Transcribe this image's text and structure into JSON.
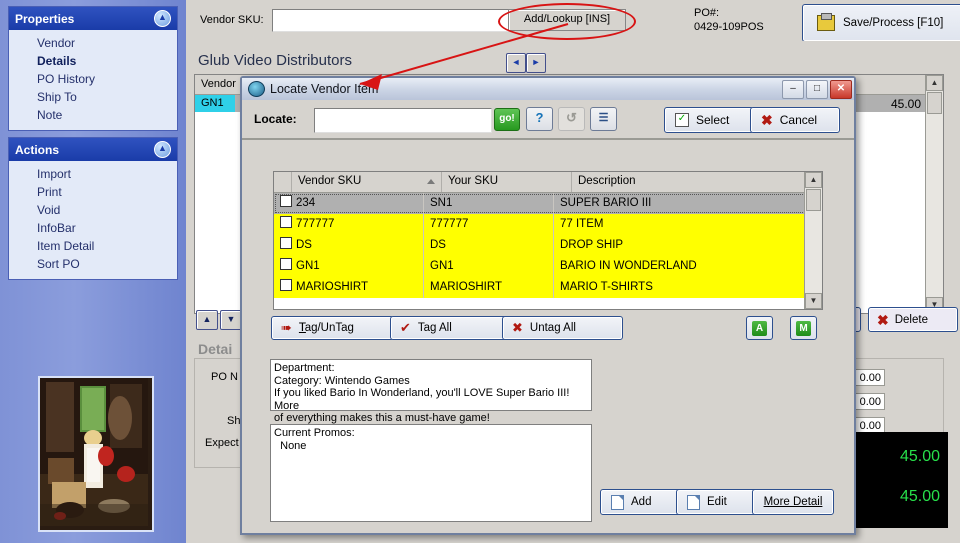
{
  "sidebar": {
    "properties": {
      "title": "Properties",
      "collapse_icon": "chevron-up-icon",
      "items": [
        {
          "label": "Vendor",
          "selected": false
        },
        {
          "label": "Details",
          "selected": true
        },
        {
          "label": "PO History",
          "selected": false
        },
        {
          "label": "Ship To",
          "selected": false
        },
        {
          "label": "Note",
          "selected": false
        }
      ]
    },
    "actions": {
      "title": "Actions",
      "collapse_icon": "chevron-up-icon",
      "items": [
        {
          "label": "Import"
        },
        {
          "label": "Print"
        },
        {
          "label": "Void"
        },
        {
          "label": "InfoBar"
        },
        {
          "label": "Item Detail"
        },
        {
          "label": "Sort PO"
        }
      ]
    },
    "thumbnail": {
      "name": "attic-painting-thumbnail"
    }
  },
  "topbar": {
    "vendor_sku_label": "Vendor SKU:",
    "vendor_sku_value": "",
    "add_lookup_label": "Add/Lookup [INS]",
    "po_label": "PO#:",
    "po_number": "0429-109POS",
    "save_process_label": "Save/Process [F10]",
    "save_icon": "save-disk-icon"
  },
  "background": {
    "vendor_title": "Glub Video Distributors",
    "nav_prev": "◄",
    "nav_next": "►",
    "grid_header": "Vendor",
    "grid_row_sku": "GN1",
    "grid_row_amount": "45.00",
    "move_up_icon": "move-up-icon",
    "move_down_icon": "move-down-icon",
    "delete_label": "Delete",
    "details_label": "Detai",
    "po_n_label": "PO N",
    "sh_label": "Sh",
    "expect_label": "Expect",
    "amounts": [
      "0.00",
      "0.00",
      "0.00"
    ],
    "totals": [
      "45.00",
      "45.00"
    ]
  },
  "dialog": {
    "title": "Locate Vendor Item",
    "title_icon": "app-globe-icon",
    "window_buttons": {
      "minimize": "–",
      "maximize": "□",
      "close": "✕"
    },
    "locate_label": "Locate:",
    "locate_value": "",
    "go_label": "go!",
    "help_label": "?",
    "refresh_label": "↺",
    "list_label": "☰",
    "select_label": "Select",
    "cancel_label": "Cancel",
    "table": {
      "columns": [
        "",
        "Vendor SKU",
        "Your SKU",
        "Description"
      ],
      "sort_column": "Vendor SKU",
      "rows": [
        {
          "checked": false,
          "vendor_sku": "234",
          "your_sku": "SN1",
          "description": "SUPER BARIO III",
          "state": "selected"
        },
        {
          "checked": false,
          "vendor_sku": "777777",
          "your_sku": "777777",
          "description": "77 ITEM",
          "state": "highlight"
        },
        {
          "checked": false,
          "vendor_sku": "DS",
          "your_sku": "DS",
          "description": "DROP SHIP",
          "state": "highlight"
        },
        {
          "checked": false,
          "vendor_sku": "GN1",
          "your_sku": "GN1",
          "description": "BARIO IN WONDERLAND",
          "state": "highlight"
        },
        {
          "checked": false,
          "vendor_sku": "MARIOSHIRT",
          "your_sku": "MARIOSHIRT",
          "description": "MARIO T-SHIRTS",
          "state": "highlight"
        }
      ]
    },
    "tag_untag_label": "Tag/UnTag",
    "tag_all_label": "Tag All",
    "untag_all_label": "Untag All",
    "a_button_label": "A",
    "m_button_label": "M",
    "description_text": "Department:\nCategory: Wintendo Games\nIf you liked Bario In Wonderland, you'll LOVE Super Bario III!  More\nof everything makes this a must-have game!",
    "promos_text": "Current Promos:\n  None",
    "add_label": "Add",
    "edit_label": "Edit",
    "more_detail_label": "More Detail"
  },
  "annotation": {
    "arrow_color": "#d81414",
    "ellipse_target": "Add/Lookup [INS]"
  }
}
